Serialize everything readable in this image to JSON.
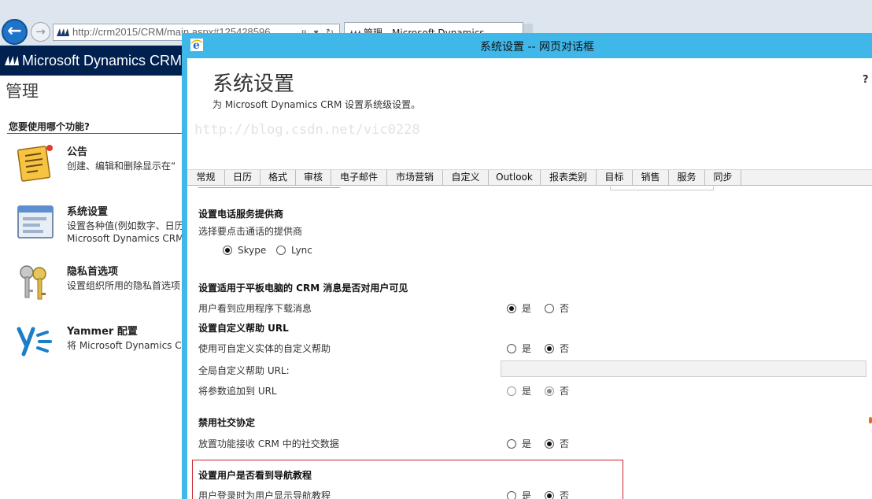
{
  "browser": {
    "url": "http://crm2015/CRM/main.aspx#125428596",
    "address_icons": "ᴘ ▾ ↻",
    "tab_label": "管理 - Microsoft Dynamics",
    "back_icon": "arrow-left-icon",
    "forward_icon": "arrow-right-icon"
  },
  "crm": {
    "app_title": "Microsoft Dynamics CRM",
    "page_title": "管理",
    "question": "您要使用哪个功能?",
    "items": [
      {
        "icon": "notepad-icon",
        "title": "公告",
        "desc": "创建、编辑和删除显示在“"
      },
      {
        "icon": "settings-window-icon",
        "title": "系统设置",
        "desc_line1": "设置各种值(例如数字、日历",
        "desc_line2": "Microsoft Dynamics CRM"
      },
      {
        "icon": "keys-icon",
        "title": "隐私首选项",
        "desc": "设置组织所用的隐私首选项"
      },
      {
        "icon": "yammer-icon",
        "title": "Yammer 配置",
        "desc": "将 Microsoft Dynamics CR"
      }
    ]
  },
  "dialog": {
    "window_title": "系统设置 -- 网页对话框",
    "title": "系统设置",
    "subtitle": "为 Microsoft Dynamics CRM 设置系统级设置。",
    "help": "?",
    "tabs": [
      "常规",
      "日历",
      "格式",
      "审核",
      "电子邮件",
      "市场营销",
      "自定义",
      "Outlook",
      "报表类别",
      "目标",
      "销售",
      "服务",
      "同步"
    ],
    "active_tab": "常规",
    "sections": {
      "phone": {
        "title": "设置电话服务提供商",
        "label": "选择要点击通话的提供商",
        "options": [
          "Skype",
          "Lync"
        ],
        "selected": "Skype"
      },
      "tablet": {
        "title": "设置适用于平板电脑的 CRM 消息是否对用户可见",
        "label": "用户看到应用程序下载消息",
        "yes": "是",
        "no": "否",
        "selected": "是"
      },
      "custom_help": {
        "title": "设置自定义帮助 URL",
        "row1_label": "使用可自定义实体的自定义帮助",
        "row1_selected": "否",
        "row2_label": "全局自定义帮助 URL:",
        "row2_value": "",
        "row3_label": "将参数追加到 URL",
        "row3_selected": "否",
        "yes": "是",
        "no": "否"
      },
      "social": {
        "title": "禁用社交协定",
        "label": "放置功能接收 CRM 中的社交数据",
        "yes": "是",
        "no": "否",
        "selected": "否"
      },
      "nav_tour": {
        "title": "设置用户是否看到导航教程",
        "label": "用户登录时为用户显示导航教程",
        "yes": "是",
        "no": "否",
        "selected": "否"
      }
    }
  },
  "watermark": "http://blog.csdn.net/vic0228",
  "colors": {
    "dialog_frame": "#3fb7e9",
    "crm_header": "#002050",
    "highlight": "#c9252b",
    "back_button": "#1f73c8"
  }
}
